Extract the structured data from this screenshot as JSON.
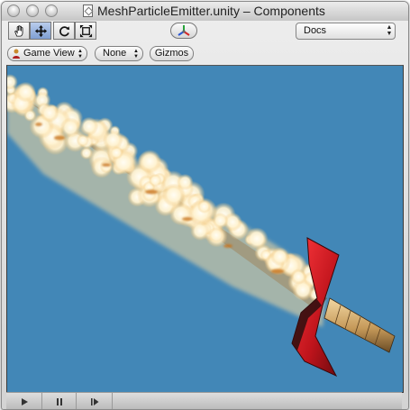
{
  "window": {
    "title": "MeshParticleEmitter.unity – Components",
    "traffic_lights": [
      "close",
      "minimize",
      "zoom"
    ]
  },
  "toolbar": {
    "tools": [
      {
        "name": "hand-tool",
        "icon": "hand-icon",
        "selected": false
      },
      {
        "name": "move-tool",
        "icon": "move-arrows-icon",
        "selected": true
      },
      {
        "name": "rotate-tool",
        "icon": "rotate-icon",
        "selected": false
      },
      {
        "name": "scale-tool",
        "icon": "scale-icon",
        "selected": false
      }
    ],
    "gizmo_toggle_icon": "axis-gizmo-icon",
    "layout_dropdown": {
      "value": "Docs"
    }
  },
  "view_controls": {
    "view_dropdown": {
      "value": "Game View",
      "icon": "camera-person-icon"
    },
    "render_mode_dropdown": {
      "value": "None"
    },
    "gizmos_button": {
      "label": "Gizmos"
    }
  },
  "viewport": {
    "background_color": "#4287b7",
    "content": "flaming-sword-scene"
  },
  "playback": {
    "buttons": [
      {
        "name": "play",
        "icon": "play-icon"
      },
      {
        "name": "pause",
        "icon": "pause-icon"
      },
      {
        "name": "step",
        "icon": "step-icon"
      }
    ]
  },
  "colors": {
    "accent_selected": "#8aa8d8",
    "blade_red": "#c0141c",
    "handle_wood": "#c69a5a",
    "fire_core": "#fff9e8",
    "fire_edge": "#e39b3a"
  }
}
